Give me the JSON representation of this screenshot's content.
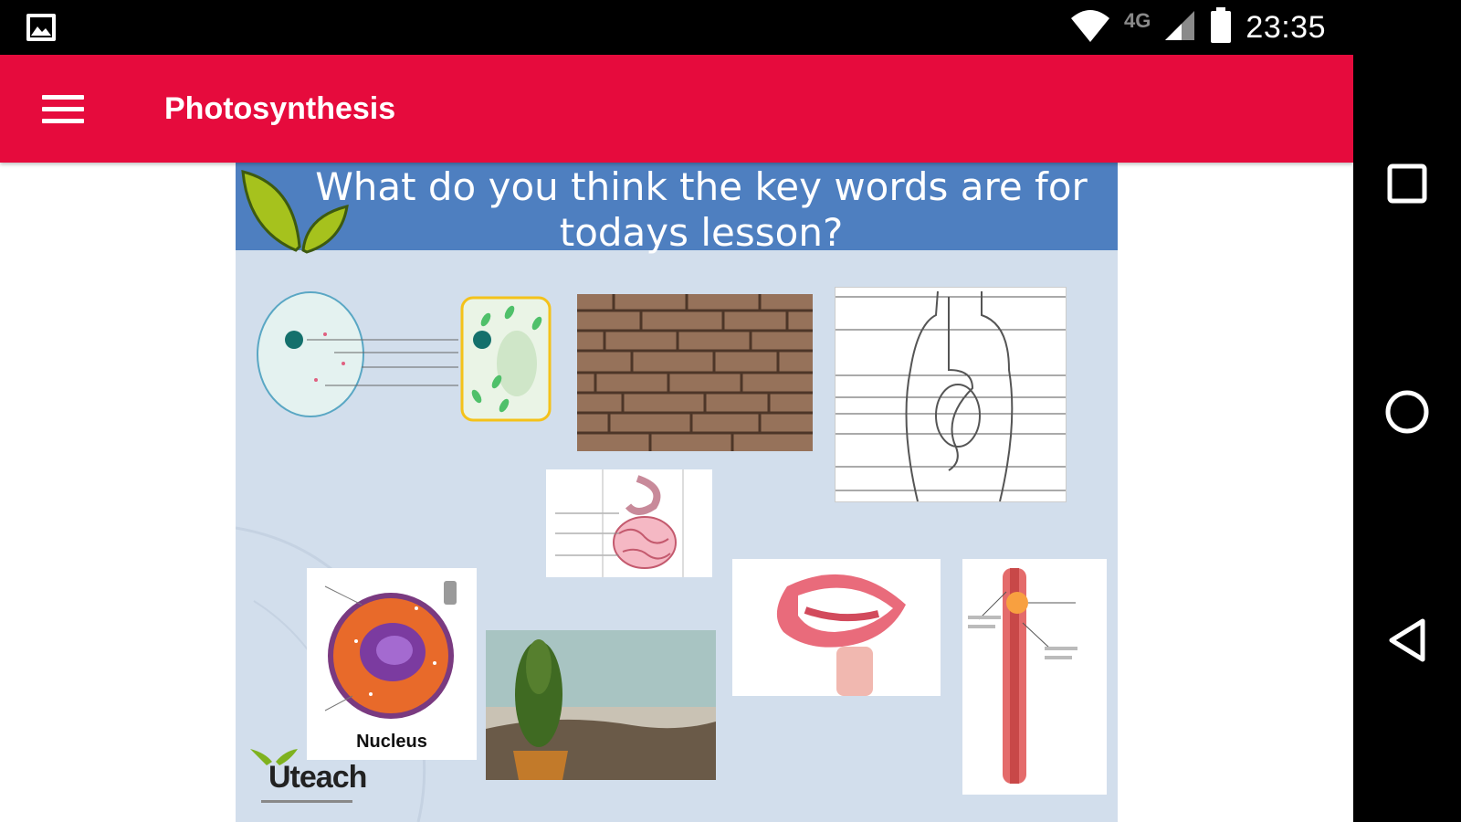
{
  "status_bar": {
    "time": "23:35",
    "network": "4G",
    "icons": [
      "image-notification-icon",
      "wifi-icon",
      "cell-signal-icon",
      "battery-icon"
    ]
  },
  "app_bar": {
    "title": "Photosynthesis",
    "menu_icon": "hamburger-menu-icon",
    "background_color": "#e60b3d"
  },
  "slide": {
    "heading_line1": "What do you think the key words are for",
    "heading_line2": "todays lesson?",
    "header_color": "#4e7fc0",
    "background_color": "#d2deec",
    "images": [
      "cell-diagram",
      "brick-wall",
      "digestive-system-diagram",
      "small-intestine",
      "nucleus-cell",
      "tree-by-sea",
      "mouth-teeth",
      "muscle-tube"
    ],
    "nucleus_caption": "Nucleus",
    "logo_text": "Uteach"
  },
  "nav_bar": {
    "buttons": [
      "recents-square-icon",
      "home-circle-icon",
      "back-triangle-icon"
    ]
  }
}
